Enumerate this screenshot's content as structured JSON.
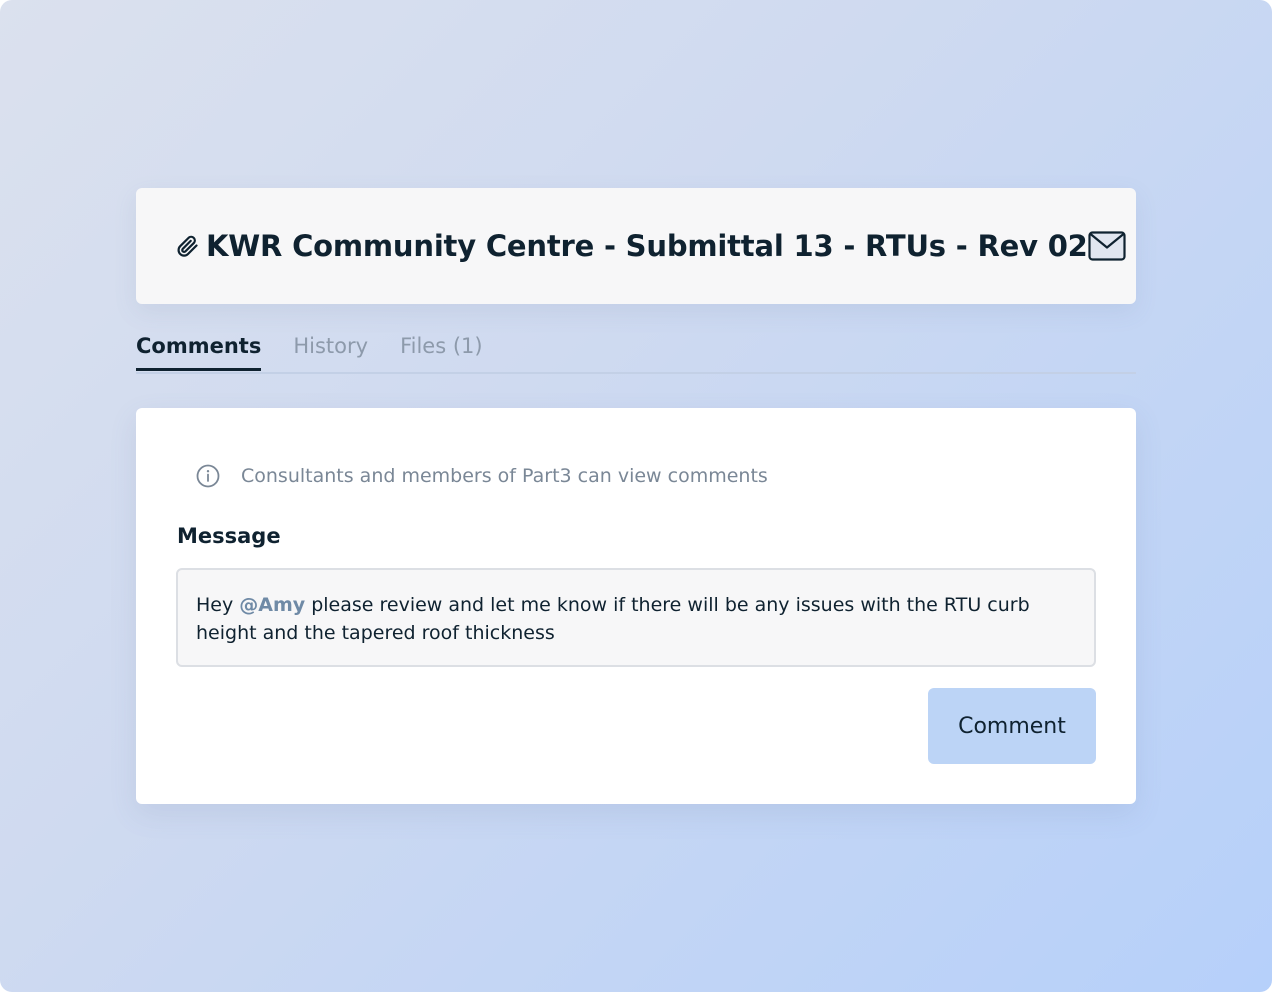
{
  "header": {
    "title": "KWR Community Centre - Submittal 13 - RTUs - Rev 02",
    "attachment_icon": "paperclip-icon",
    "mail_icon": "envelope-icon"
  },
  "tabs": [
    {
      "label": "Comments",
      "active": true
    },
    {
      "label": "History",
      "active": false
    },
    {
      "label": "Files (1)",
      "active": false
    }
  ],
  "comment_panel": {
    "notice_icon": "info-icon",
    "notice_text": "Consultants and members of Part3 can view comments",
    "message_label": "Message",
    "message": {
      "prefix": "Hey ",
      "mention": "@Amy",
      "suffix": " please review and let me know if there will be any issues with the RTU curb height and the tapered roof thickness"
    },
    "submit_label": "Comment"
  },
  "colors": {
    "text_primary": "#0f2230",
    "text_muted": "#8d9aab",
    "mention": "#6f8aa6",
    "button_bg": "#bcd4f6",
    "card_bg": "#f7f7f8"
  }
}
